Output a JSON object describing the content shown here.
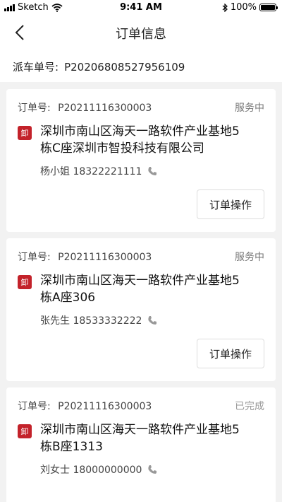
{
  "status_bar": {
    "carrier": "Sketch",
    "time": "9:41 AM",
    "battery": "100%",
    "battery_level": 1.0
  },
  "nav": {
    "title": "订单信息"
  },
  "dispatch": {
    "label": "派车单号:",
    "number": "P20206808527956109"
  },
  "orders": [
    {
      "order_label": "订单号:",
      "order_no": "P20211116300003",
      "status": "服务中",
      "badge": "卸",
      "address_line1": "深圳市南山区海天一路软件产业基地5",
      "address_line2": "栋C座深圳市智投科技有限公司",
      "contact": "杨小姐 18322221111",
      "action": "订单操作"
    },
    {
      "order_label": "订单号:",
      "order_no": "P20211116300003",
      "status": "服务中",
      "badge": "卸",
      "address_line1": "深圳市南山区海天一路软件产业基地5",
      "address_line2": "栋A座306",
      "contact": "张先生 18533332222",
      "action": "订单操作"
    },
    {
      "order_label": "订单号:",
      "order_no": "P20211116300003",
      "status": "已完成",
      "badge": "卸",
      "address_line1": "深圳市南山区海天一路软件产业基地5",
      "address_line2": "栋B座1313",
      "contact": "刘女士 18000000000"
    }
  ]
}
